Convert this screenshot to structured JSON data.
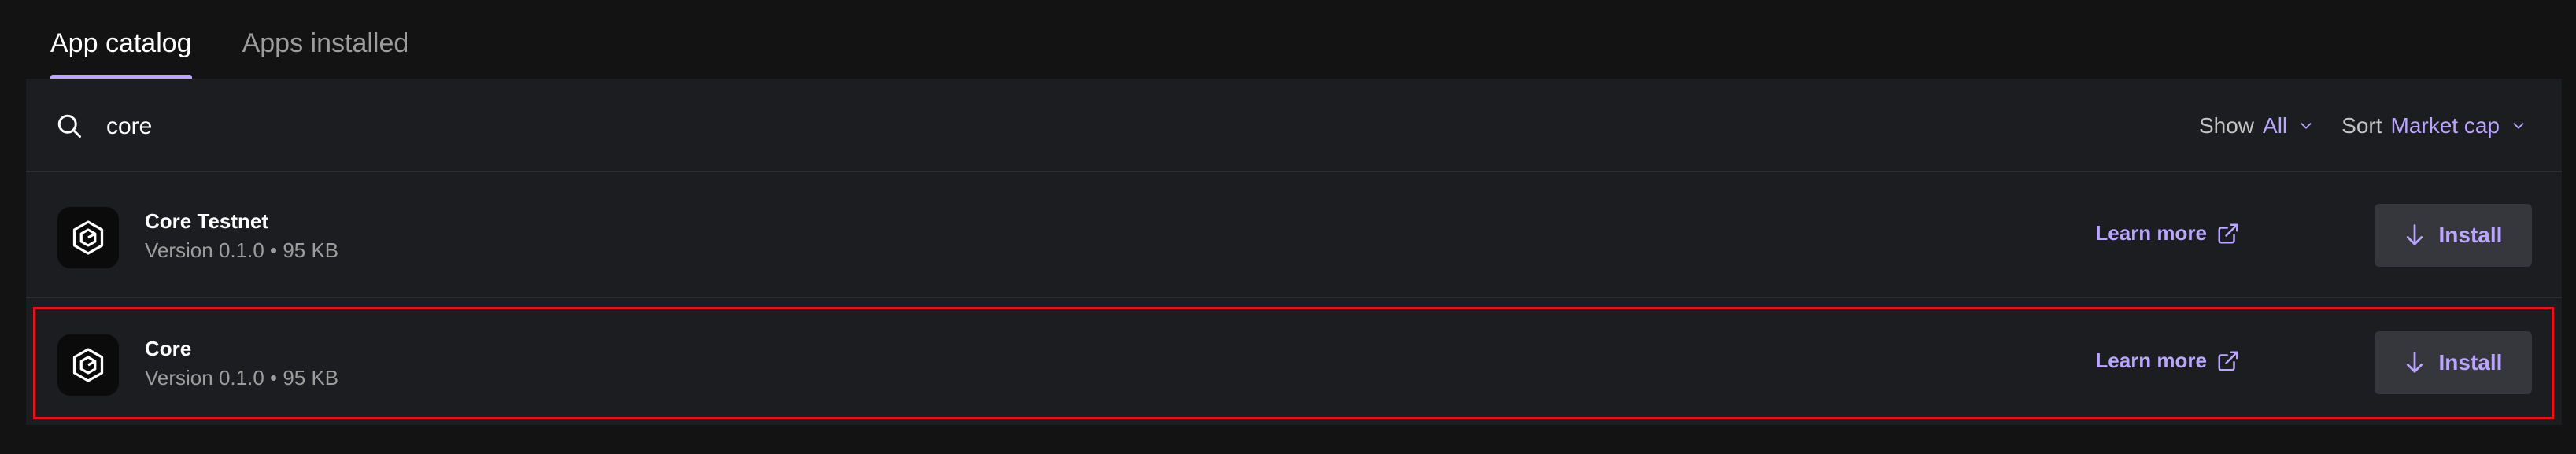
{
  "tabs": [
    {
      "label": "App catalog",
      "active": true
    },
    {
      "label": "Apps installed",
      "active": false
    }
  ],
  "search": {
    "value": "core",
    "icon": "search-icon"
  },
  "filters": {
    "show": {
      "label": "Show",
      "value": "All"
    },
    "sort": {
      "label": "Sort",
      "value": "Market cap"
    }
  },
  "apps": [
    {
      "name": "Core Testnet",
      "meta": "Version 0.1.0 • 95 KB",
      "learn_more": "Learn more",
      "install": "Install",
      "icon": "core-logo-icon"
    },
    {
      "name": "Core",
      "meta": "Version 0.1.0 • 95 KB",
      "learn_more": "Learn more",
      "install": "Install",
      "icon": "core-logo-icon",
      "highlighted": true
    }
  ],
  "colors": {
    "background": "#131314",
    "panel": "#1c1d20",
    "accent": "#bba6ff",
    "highlight_border": "#e3141b",
    "button_bg": "#36373c"
  }
}
